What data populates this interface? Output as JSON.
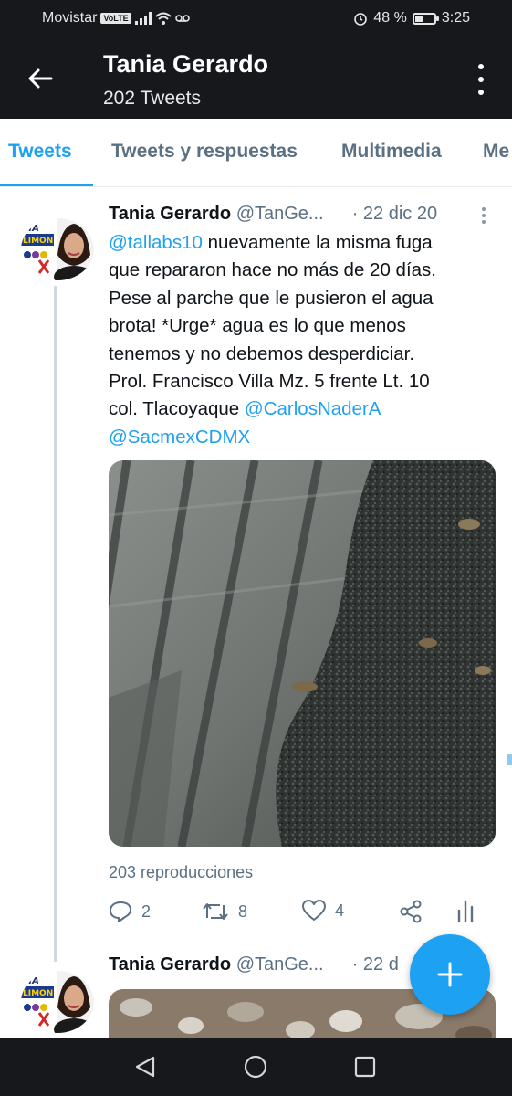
{
  "status_bar": {
    "carrier": "Movistar",
    "volte": "VoLTE",
    "battery": "48 %",
    "battery_level": 0.48,
    "time": "3:25"
  },
  "header": {
    "title": "Tania Gerardo",
    "subtitle": "202 Tweets"
  },
  "tabs": [
    {
      "label": "Tweets",
      "active": true
    },
    {
      "label": "Tweets y respuestas"
    },
    {
      "label": "Multimedia"
    },
    {
      "label": "Me"
    }
  ],
  "tweets": [
    {
      "name": "Tania Gerardo",
      "handle": "@TanGe...",
      "date": "· 22 dic 20",
      "text_lines": [
        {
          "mention": "@tallabs10",
          "text": " nuevamente la misma fuga"
        },
        {
          "text": "que repararon hace no más de 20 días."
        },
        {
          "text": "Pese al parche que le pusieron el agua"
        },
        {
          "text": "brota! *Urge* agua es lo que menos"
        },
        {
          "text": "tenemos y no debemos desperdiciar."
        },
        {
          "text": "Prol. Francisco Villa Mz. 5 frente Lt. 10"
        },
        {
          "text": "col. Tlacoyaque ",
          "mention": "@CarlosNaderA"
        },
        {
          "mention": "@SacmexCDMX"
        }
      ],
      "views": "203 reproducciones",
      "replies": "2",
      "retweets": "8",
      "likes": "4"
    },
    {
      "name": "Tania Gerardo",
      "handle": "@TanGe...",
      "date": "· 22 d"
    }
  ],
  "avatar_badge": {
    "line1": "LIA",
    "line2": "LIMON"
  },
  "colors": {
    "accent": "#1da1f2",
    "dark": "#16181c",
    "muted": "#5b7083"
  }
}
